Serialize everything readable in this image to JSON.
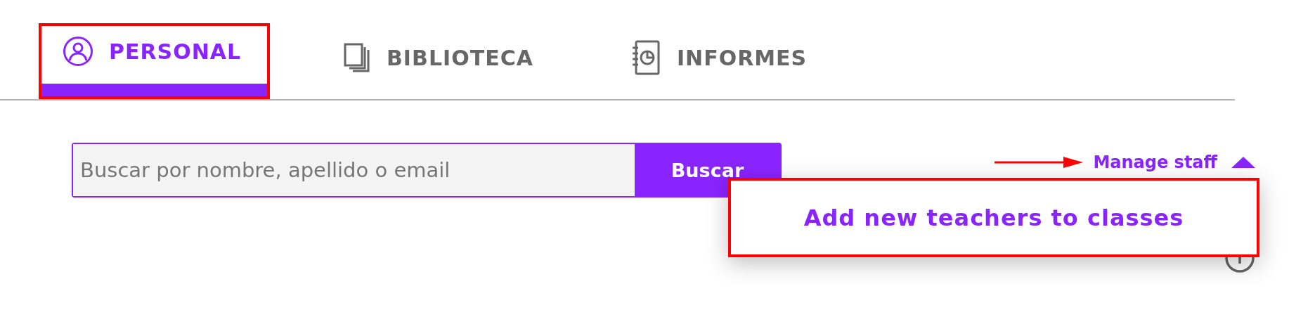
{
  "tabs": [
    {
      "label": "PERSONAL",
      "kind": "person",
      "selected": true,
      "highlighted": true
    },
    {
      "label": "BIBLIOTECA",
      "kind": "pages",
      "selected": false,
      "highlighted": false
    },
    {
      "label": "INFORMES",
      "kind": "report",
      "selected": false,
      "highlighted": false
    }
  ],
  "search": {
    "placeholder": "Buscar por nombre, apellido o email",
    "button": "Buscar"
  },
  "manage_menu": {
    "label": "Manage staff",
    "expanded": true,
    "items": [
      {
        "label": "Add new teachers to classes",
        "highlighted": true
      }
    ]
  }
}
